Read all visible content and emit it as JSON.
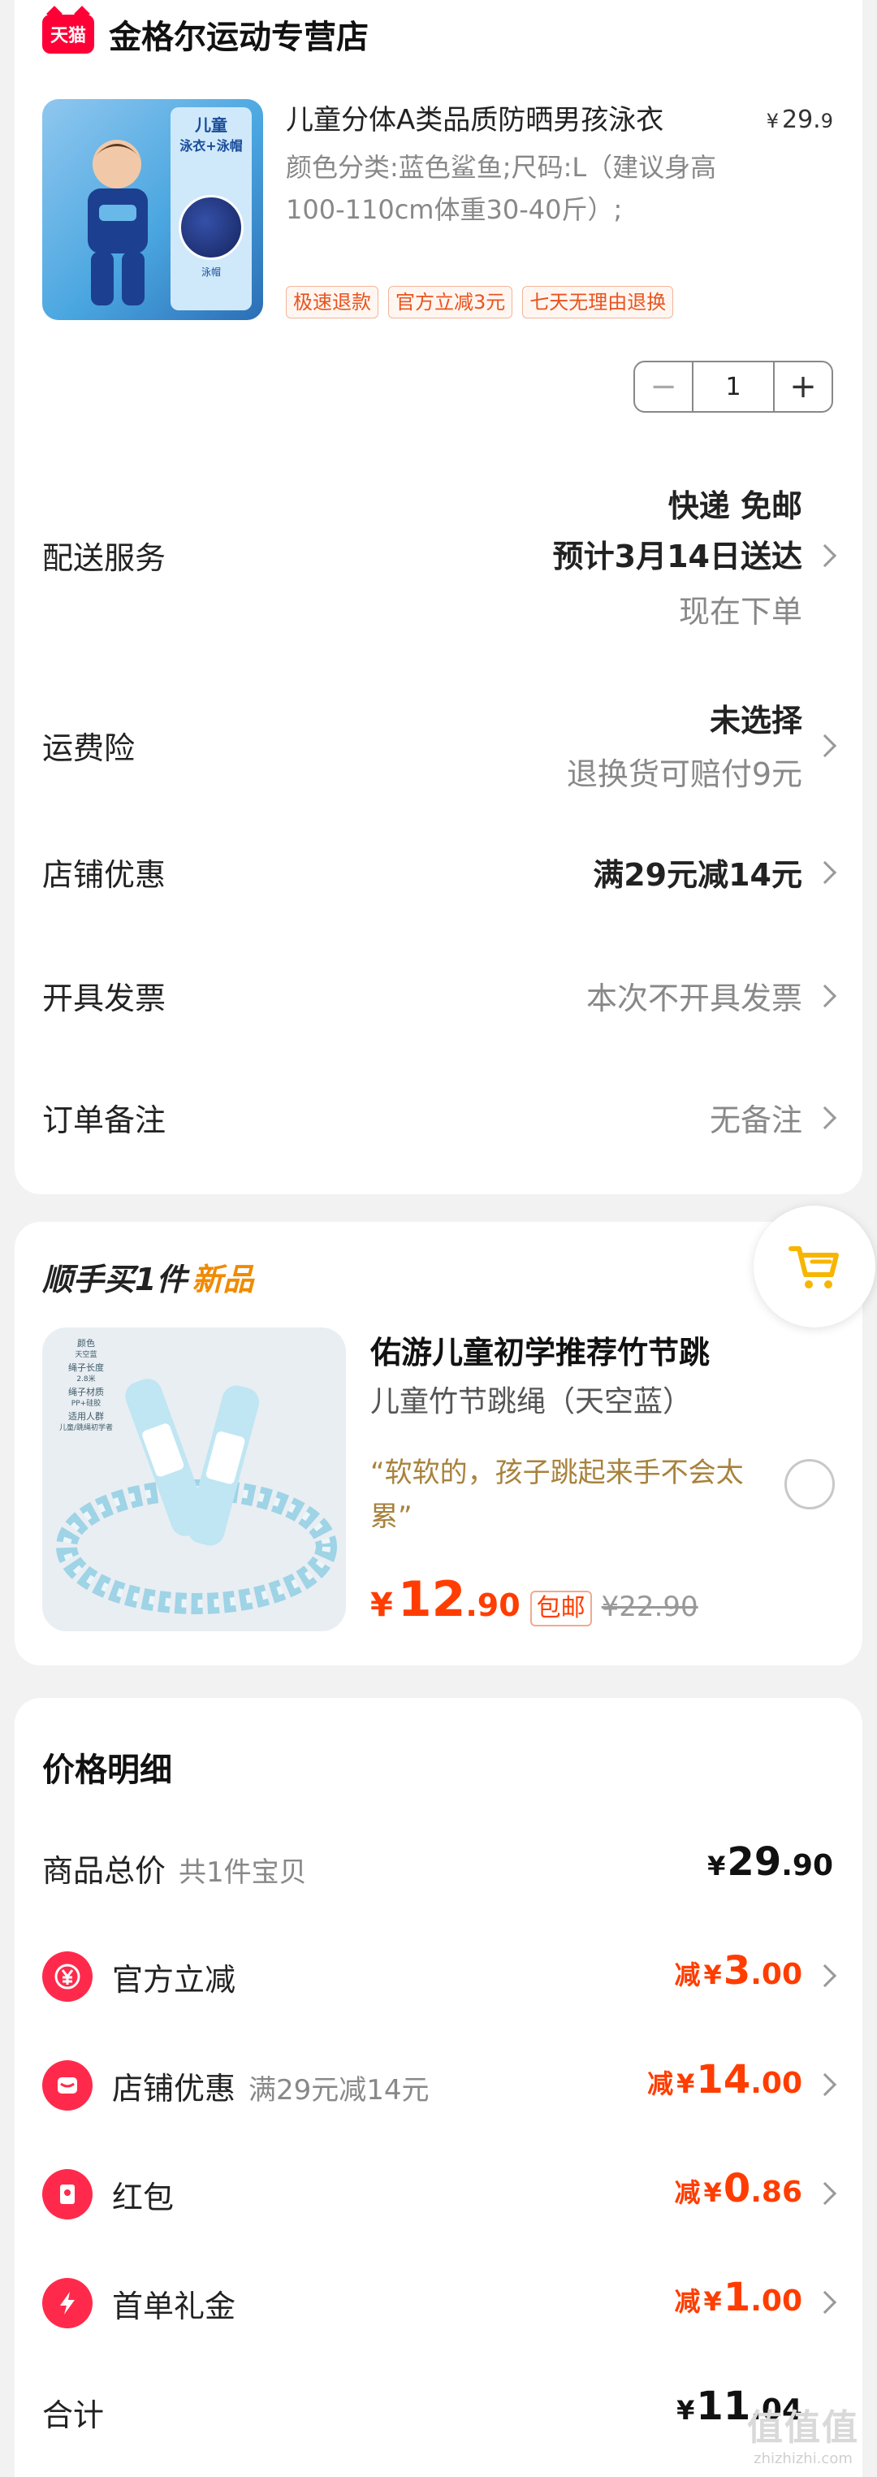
{
  "shop": {
    "logo_text": "天猫",
    "name": "金格尔运动专营店"
  },
  "product": {
    "title": "儿童分体A类品质防晒男孩泳衣",
    "price_currency": "¥",
    "price_int": "29.",
    "price_dec": "9",
    "spec": "颜色分类:蓝色鲨鱼;尺码:L（建议身高100-110cm体重30-40斤）;",
    "tags": [
      "极速退款",
      "官方立减3元",
      "七天无理由退换"
    ],
    "image_text": {
      "line1": "儿童",
      "line2": "泳衣+泳帽",
      "cap": "泳帽"
    },
    "quantity": "1",
    "minus": "−",
    "plus": "+"
  },
  "order_rows": {
    "shipping": {
      "method": "快递 免邮",
      "label": "配送服务",
      "eta": "预计3月14日送达",
      "note": "现在下单"
    },
    "insurance": {
      "label": "运费险",
      "value": "未选择",
      "note": "退换货可赔付9元"
    },
    "coupon": {
      "label": "店铺优惠",
      "value": "满29元减14元"
    },
    "invoice": {
      "label": "开具发票",
      "value": "本次不开具发票"
    },
    "remark": {
      "label": "订单备注",
      "value": "无备注"
    }
  },
  "addon": {
    "heading": "顺手买1件",
    "heading_tag": "新品",
    "title": "佑游儿童初学推荐竹节跳",
    "subtitle": "儿童竹节跳绳（天空蓝）",
    "quote": "“软软的，孩子跳起来手不会太累”",
    "price_currency": "¥",
    "price_int": "12",
    "price_dec": ".90",
    "free_shipping": "包邮",
    "original_price": "¥22.90",
    "image_text": {
      "color_label": "颜色",
      "color_value": "天空蓝",
      "length_label": "绳子长度",
      "length_value": "2.8米",
      "material_label": "绳子材质",
      "material_value": "PP+硅胶",
      "crowd_label": "适用人群",
      "crowd_value": "儿童/跳绳初学者"
    }
  },
  "price_detail": {
    "title": "价格明细",
    "rows": [
      {
        "label": "商品总价",
        "sub": "共1件宝贝",
        "prefix": "",
        "currency": "¥",
        "int": "29",
        "dec": ".90",
        "icon": ""
      },
      {
        "label": "官方立减",
        "sub": "",
        "prefix": "减",
        "currency": "¥",
        "int": "3",
        "dec": ".00",
        "icon": "yuan-icon"
      },
      {
        "label": "店铺优惠",
        "sub": "满29元减14元",
        "prefix": "减",
        "currency": "¥",
        "int": "14",
        "dec": ".00",
        "icon": "shop-icon"
      },
      {
        "label": "红包",
        "sub": "",
        "prefix": "减",
        "currency": "¥",
        "int": "0",
        "dec": ".86",
        "icon": "red-packet-icon"
      },
      {
        "label": "首单礼金",
        "sub": "",
        "prefix": "减",
        "currency": "¥",
        "int": "1",
        "dec": ".00",
        "icon": "lightning-icon"
      }
    ],
    "total": {
      "label": "合计",
      "currency": "¥",
      "int": "11",
      "dec": ".04"
    }
  },
  "watermark": {
    "main": "值值值",
    "url": "zhizhizhi.com"
  },
  "colors": {
    "accent_red": "#ff3d00",
    "brand_tmall": "#ff0036",
    "addon_new": "#f08a00",
    "quote": "#a8823c"
  }
}
